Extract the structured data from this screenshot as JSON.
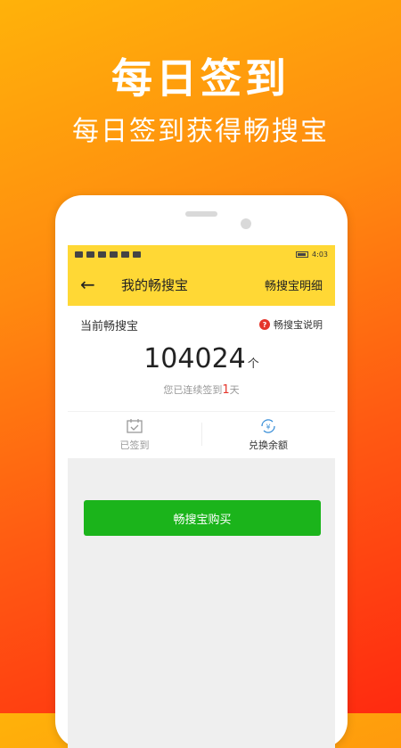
{
  "promo": {
    "title": "每日签到",
    "subtitle": "每日签到获得畅搜宝"
  },
  "statusbar": {
    "time": "4:03"
  },
  "appbar": {
    "back_icon": "back-arrow-icon",
    "title": "我的畅搜宝",
    "action_label": "畅搜宝明细"
  },
  "points_card": {
    "current_label": "当前畅搜宝",
    "explain_label": "畅搜宝说明",
    "value": "104024",
    "unit": "个",
    "streak_prefix": "您已连续签到",
    "streak_days": "1",
    "streak_suffix": "天"
  },
  "actions": {
    "signed_label": "已签到",
    "exchange_label": "兑换余额"
  },
  "buy_button": {
    "label": "畅搜宝购买"
  },
  "colors": {
    "accent_yellow": "#ffd835",
    "button_green": "#1bb41b",
    "highlight_red": "#e5352b"
  }
}
